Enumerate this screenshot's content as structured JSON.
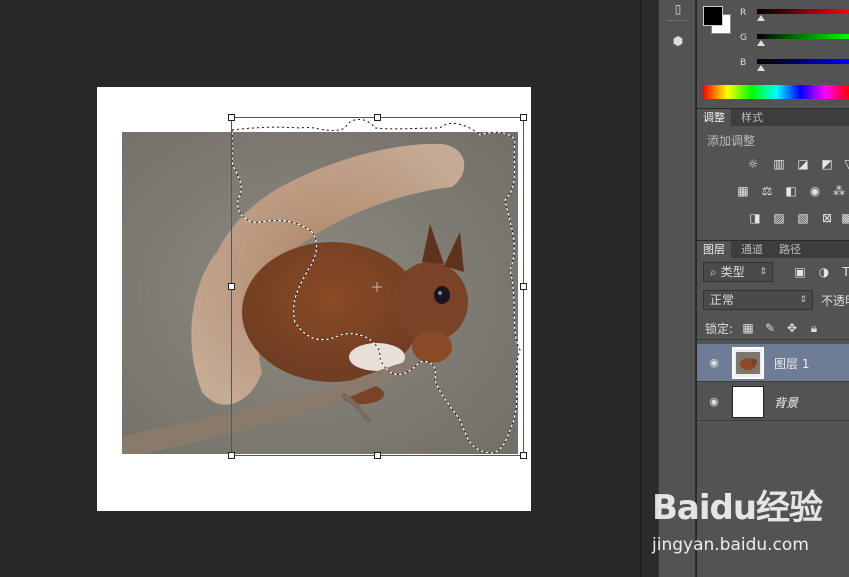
{
  "color_panel": {
    "channels": [
      {
        "label": "R",
        "value_fraction": 0.0,
        "color": "#ff0000"
      },
      {
        "label": "G",
        "value_fraction": 0.0,
        "color": "#00ff00"
      },
      {
        "label": "B",
        "value_fraction": 0.0,
        "color": "#0000ff"
      }
    ],
    "foreground_color": "#000000",
    "background_color": "#ffffff"
  },
  "adjustments_panel": {
    "tabs": [
      "调整",
      "样式"
    ],
    "add_label": "添加调整",
    "icons": [
      "brightness-icon",
      "levels-icon",
      "curves-icon",
      "exposure-icon",
      "vibrance-icon",
      "hue-saturation-icon",
      "color-balance-icon",
      "black-white-icon",
      "photo-filter-icon",
      "channel-mixer-icon",
      "invert-icon",
      "posterize-icon",
      "threshold-icon",
      "selective-color-icon",
      "gradient-map-icon"
    ]
  },
  "layers_panel": {
    "tabs": [
      "图层",
      "通道",
      "路径"
    ],
    "filter_kind": "类型",
    "blend_mode": "正常",
    "opacity_label": "不透明",
    "lock_label": "锁定:",
    "layers": [
      {
        "name": "图层 1",
        "selected": true,
        "visible": true
      },
      {
        "name": "背景",
        "selected": false,
        "visible": true,
        "italic": true
      }
    ]
  },
  "watermark": {
    "logo": "Baidu经验",
    "url": "jingyan.baidu.com"
  }
}
